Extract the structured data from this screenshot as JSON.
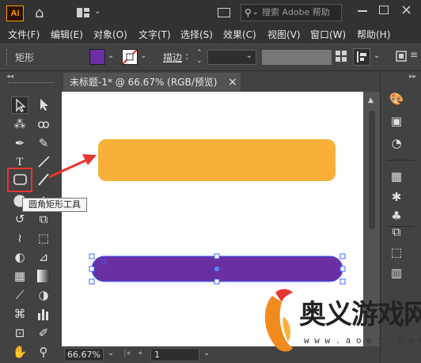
{
  "app": {
    "logo": "Ai",
    "search_placeholder": "搜索 Adobe 帮助"
  },
  "menubar": {
    "items": [
      "文件(F)",
      "编辑(E)",
      "对象(O)",
      "文字(T)",
      "选择(S)",
      "效果(C)",
      "视图(V)",
      "窗口(W)",
      "帮助(H)"
    ]
  },
  "controlbar": {
    "selection_label": "矩形",
    "stroke_label": "描边",
    "fill_color": "#6a2fa0",
    "stroke_color": "none"
  },
  "document": {
    "tab_title": "未标题-1* @ 66.67% (RGB/预览)",
    "close_glyph": "×"
  },
  "canvas": {
    "orange_rect_color": "#f9b03a",
    "purple_rect_color": "#6a2fa0",
    "arrow_color": "#e8352f"
  },
  "tooltip": {
    "text": "圆角矩形工具"
  },
  "statusbar": {
    "zoom": "66.67%",
    "artboard_number": "1"
  },
  "watermark": {
    "title": "奥义游戏网",
    "url": "w w w . a o e 1 . c o m"
  },
  "icons": {
    "home": "⌂",
    "close": "×"
  }
}
